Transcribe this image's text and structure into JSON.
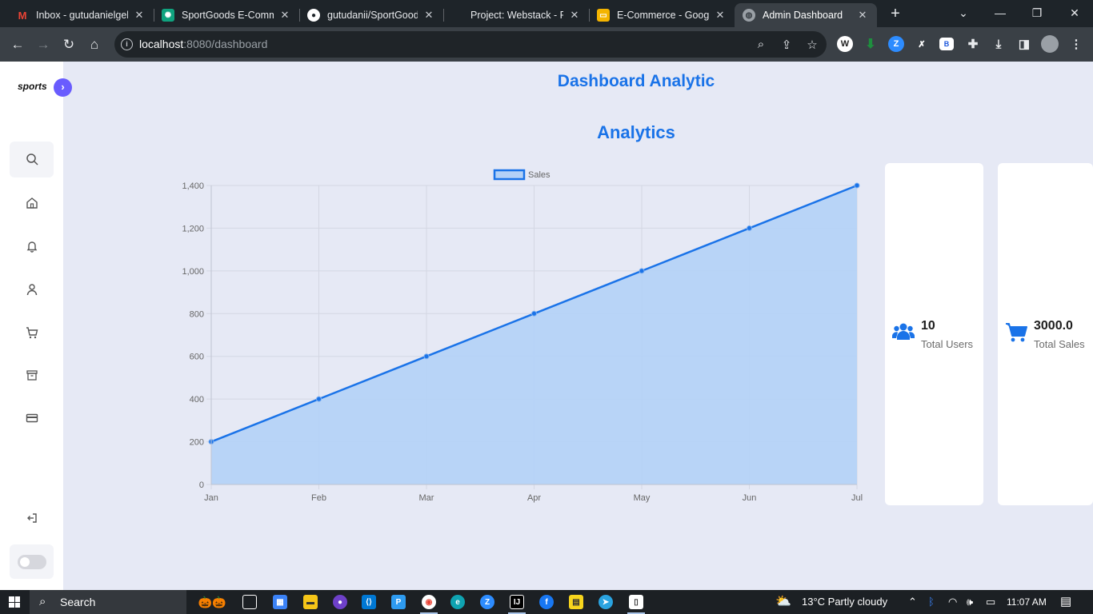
{
  "browser": {
    "tabs": [
      {
        "title": "Inbox - gutudanielgele",
        "favicon": "gmail-icon",
        "color": "#ea4335"
      },
      {
        "title": "SportGoods E-Comme",
        "favicon": "chatgpt-icon",
        "color": "#10a37f"
      },
      {
        "title": "gutudanii/SportGoods",
        "favicon": "github-icon",
        "color": "#ffffff"
      },
      {
        "title": "Project: Webstack - Po",
        "favicon": "",
        "color": ""
      },
      {
        "title": "E-Commerce - Google",
        "favicon": "google-slides-icon",
        "color": "#f4b400"
      },
      {
        "title": "Admin Dashboard",
        "favicon": "globe-icon",
        "color": "#9aa0a6",
        "active": true
      }
    ],
    "url_host": "localhost",
    "url_path": ":8080/dashboard"
  },
  "sidebar": {
    "logo": "sports",
    "items": [
      {
        "name": "search-icon"
      },
      {
        "name": "home-icon"
      },
      {
        "name": "bell-icon"
      },
      {
        "name": "user-icon"
      },
      {
        "name": "cart-icon"
      },
      {
        "name": "archive-icon"
      },
      {
        "name": "credit-card-icon"
      },
      {
        "name": "logout-icon"
      }
    ]
  },
  "main": {
    "title": "Dashboard Analytic",
    "subtitle": "Analytics"
  },
  "chart_data": {
    "type": "line",
    "fill": "area",
    "categories": [
      "Jan",
      "Feb",
      "Mar",
      "Apr",
      "May",
      "Jun",
      "Jul"
    ],
    "series": [
      {
        "name": "Sales",
        "values": [
          200,
          400,
          600,
          800,
          1000,
          1200,
          1400
        ],
        "color": "#1a73e8",
        "fill_color": "#b3d1f7"
      }
    ],
    "y_ticks": [
      "0",
      "200",
      "400",
      "600",
      "800",
      "1,000",
      "1,200",
      "1,400"
    ],
    "ylim": [
      0,
      1400
    ],
    "grid": true,
    "legend": "top-center"
  },
  "cards": [
    {
      "value": "10",
      "label": "Total Users",
      "icon": "users-icon"
    },
    {
      "value": "3000.0",
      "label": "Total Sales",
      "icon": "cart-icon"
    }
  ],
  "taskbar": {
    "search_label": "Search",
    "weather": "13°C  Partly cloudy",
    "time": "11:07 AM"
  }
}
